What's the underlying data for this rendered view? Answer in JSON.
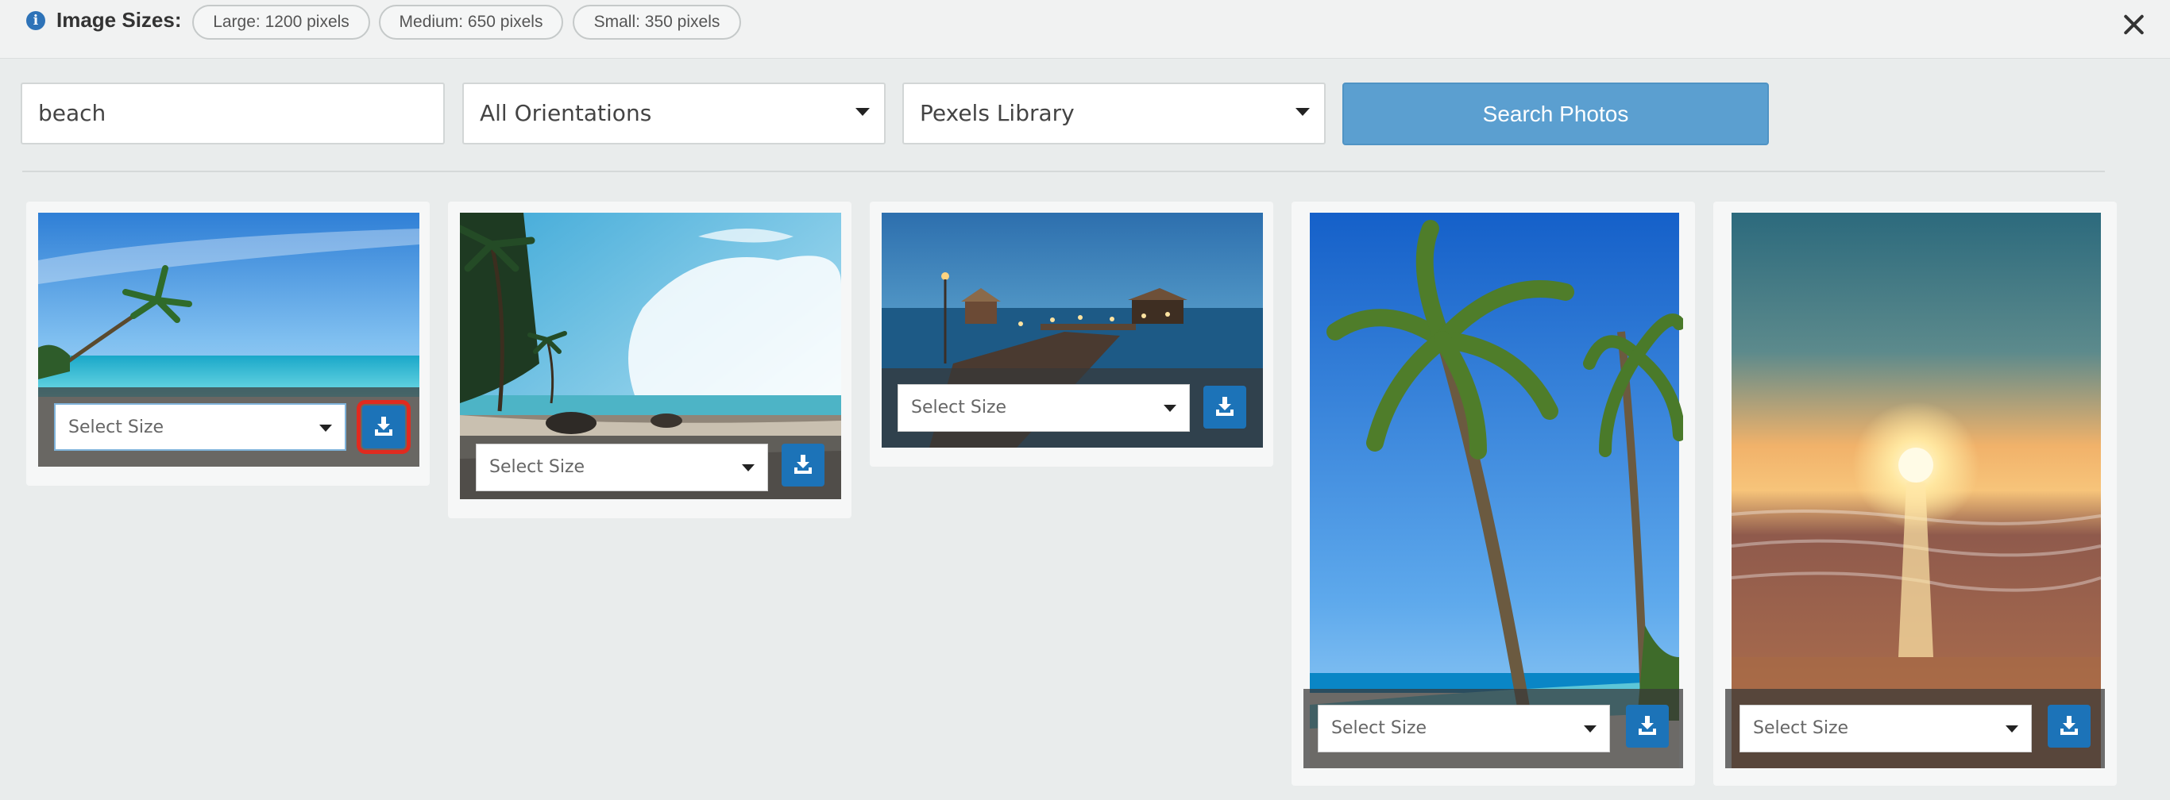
{
  "header": {
    "info_icon": "info-icon",
    "sizes_label": "Image Sizes:",
    "sizes": [
      "Large: 1200 pixels",
      "Medium: 650 pixels",
      "Small: 350 pixels"
    ],
    "close_icon": "close-icon"
  },
  "search": {
    "query": "beach",
    "orientation": "All Orientations",
    "library": "Pexels Library",
    "button_label": "Search Photos"
  },
  "results": [
    {
      "description": "beach with leaning palm tree",
      "select_placeholder": "Select Size",
      "download_icon": "download-icon"
    },
    {
      "description": "palm trees and clouds over rocky shore",
      "select_placeholder": "Select Size",
      "download_icon": "download-icon"
    },
    {
      "description": "wooden pier with huts at dusk",
      "select_placeholder": "Select Size",
      "download_icon": "download-icon"
    },
    {
      "description": "tall palm tree over beach",
      "select_placeholder": "Select Size",
      "download_icon": "download-icon"
    },
    {
      "description": "sunset over ocean waves",
      "select_placeholder": "Select Size",
      "download_icon": "download-icon"
    }
  ],
  "colors": {
    "accent": "#1c73b8",
    "search_button": "#5b9fd0",
    "highlight": "#e12a1f"
  }
}
